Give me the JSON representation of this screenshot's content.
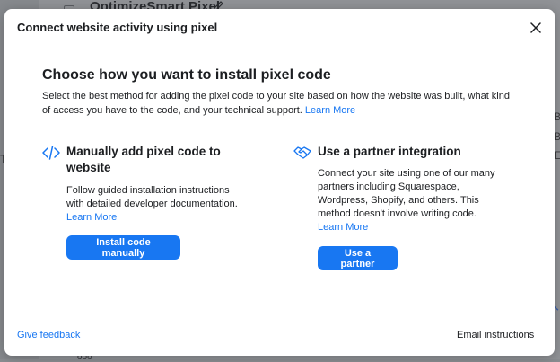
{
  "background": {
    "page_title": "OptimizeSmart Pixel",
    "left_fragment": "T",
    "right_fragments": [
      "B",
      "B",
      "E"
    ],
    "bottom_fragment": "ooo"
  },
  "modal": {
    "title": "Connect website activity using pixel",
    "close_icon": "close-icon",
    "heading": "Choose how you want to install pixel code",
    "intro": "Select the best method for adding the pixel code to your site based on how the website was built, what kind of access you have to the code, and your technical support.",
    "intro_link": "Learn More",
    "options": [
      {
        "icon": "code-icon",
        "title": "Manually add pixel code to website",
        "description": "Follow guided installation instructions with detailed developer documentation.",
        "link": "Learn More",
        "button": "Install code manually"
      },
      {
        "icon": "handshake-icon",
        "title": "Use a partner integration",
        "description": "Connect your site using one of our many partners including Squarespace, Wordpress, Shopify, and others. This method doesn't involve writing code.",
        "link": "Learn More",
        "button": "Use a partner"
      }
    ],
    "footer": {
      "feedback": "Give feedback",
      "email": "Email instructions"
    }
  },
  "colors": {
    "accent": "#1877f2",
    "text": "#1c1e21",
    "overlay": "#8a8d91"
  }
}
